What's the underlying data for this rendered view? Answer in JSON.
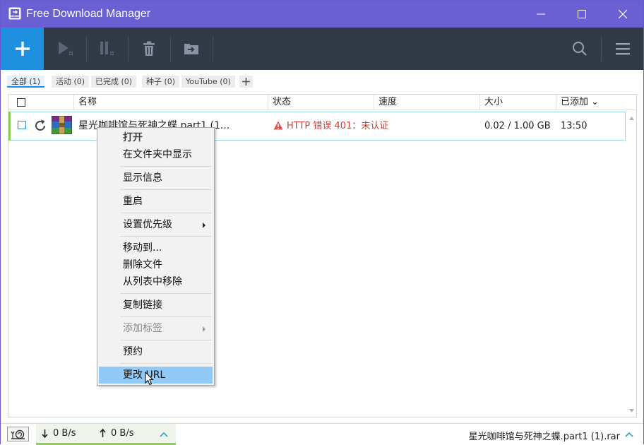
{
  "window": {
    "title": "Free Download Manager",
    "accent_color": "#6b5fd4",
    "toolbar_color": "#323a48",
    "add_button_color": "#1f8fe0"
  },
  "toolbar": {
    "icons": [
      "plus-icon",
      "play-icon",
      "pause-icon",
      "trash-icon",
      "move-folder-icon",
      "search-icon",
      "menu-icon"
    ]
  },
  "filters": {
    "tabs": [
      "全部 (1)",
      "活动 (0)",
      "已完成 (0)",
      "种子 (0)",
      "YouTube (0)"
    ],
    "active": "全部 (1)"
  },
  "columns": {
    "name": "名称",
    "status": "状态",
    "speed": "速度",
    "size": "大小",
    "added": "已添加 ⌄"
  },
  "download": {
    "name": "星光咖啡馆与死神之蝶.part1 (1...",
    "status": "HTTP 错误 401：未认证",
    "status_color": "#c8403a",
    "speed": "",
    "size": "0.02 / 1.00 GB",
    "added": "13:50"
  },
  "context_menu": {
    "open": "打开",
    "show_in_folder": "在文件夹中显示",
    "show_info": "显示信息",
    "restart": "重启",
    "set_priority": "设置优先级",
    "move_to": "移动到...",
    "delete_files": "删除文件",
    "remove_from_list": "从列表中移除",
    "copy_link": "复制链接",
    "add_tag": "添加标签",
    "schedule": "预约",
    "change_url": "更改 URL"
  },
  "statusbar": {
    "download_speed": "0 B/s",
    "upload_speed": "0 B/s",
    "current_file": "星光咖啡馆与死神之蝶.part1 (1).rar"
  }
}
